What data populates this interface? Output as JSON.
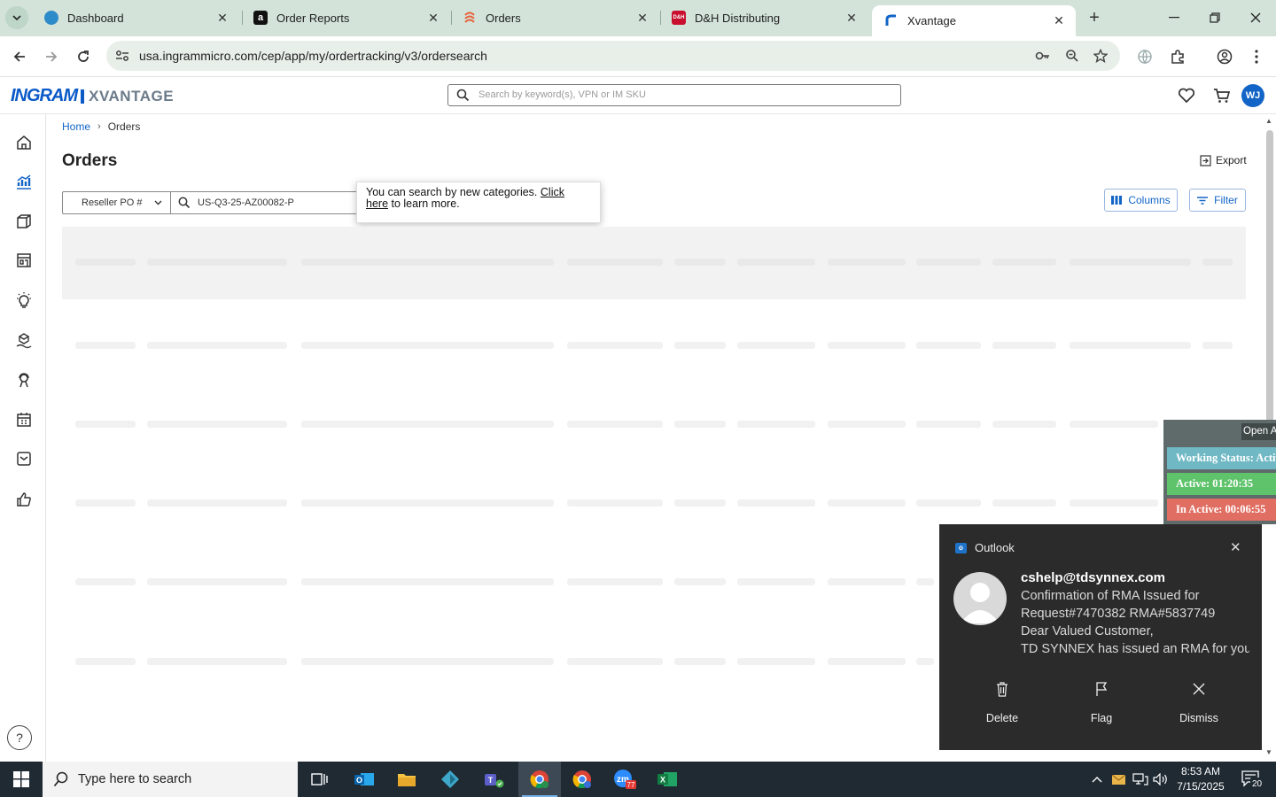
{
  "browser": {
    "tabs": [
      {
        "title": "Dashboard",
        "icon": "dashboard-favicon"
      },
      {
        "title": "Order Reports",
        "icon": "amazon-favicon"
      },
      {
        "title": "Orders",
        "icon": "orders-favicon"
      },
      {
        "title": "D&H Distributing",
        "icon": "dh-favicon"
      },
      {
        "title": "Xvantage",
        "icon": "xvantage-favicon",
        "active": true
      }
    ],
    "url": "usa.ingrammicro.com/cep/app/my/ordertracking/v3/ordersearch"
  },
  "header": {
    "logo_brand": "INGRAM",
    "logo_product": "XVANTAGE",
    "search_placeholder": "Search by keyword(s), VPN or IM SKU",
    "avatar_initials": "WJ",
    "accent_color": "#1264c7"
  },
  "breadcrumb": {
    "home": "Home",
    "current": "Orders"
  },
  "page": {
    "title": "Orders",
    "export_label": "Export",
    "search_category": "Reseller PO #",
    "search_value": "US-Q3-25-AZ00082-P",
    "columns_label": "Columns",
    "filter_label": "Filter"
  },
  "tooltip": {
    "text": "You can search by new categories. ",
    "link_part1": "Click",
    "link_part2": "here",
    "text_end": " to learn more."
  },
  "activity": {
    "open_label": "Open A",
    "working_status": "Working Status: Active",
    "active_time": "Active: 01:20:35",
    "inactive_time": "In Active: 00:06:55",
    "colors": {
      "working": "#6fb8c4",
      "active": "#5ec36b",
      "inactive": "#e06e62"
    }
  },
  "toast": {
    "app": "Outlook",
    "sender": "cshelp@tdsynnex.com",
    "lines": [
      "Confirmation of RMA Issued for",
      "Request#7470382 RMA#5837749",
      "Dear Valued Customer,",
      "TD SYNNEX has issued an RMA for you"
    ],
    "actions": {
      "delete": "Delete",
      "flag": "Flag",
      "dismiss": "Dismiss"
    }
  },
  "taskbar": {
    "search_placeholder": "Type here to search",
    "time": "8:53 AM",
    "date": "7/15/2025",
    "notification_count": "20",
    "zoom_badge": "77"
  }
}
